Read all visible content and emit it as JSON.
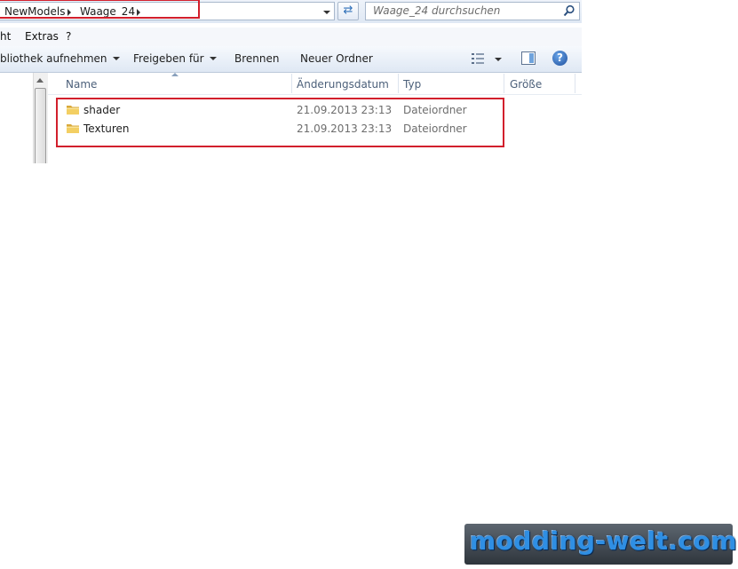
{
  "address": {
    "breadcrumbs": [
      "NewModels",
      "Waage_24"
    ],
    "search_placeholder": "Waage_24 durchsuchen"
  },
  "menu": {
    "items": [
      "ht",
      "Extras",
      "?"
    ]
  },
  "toolbar": {
    "include_library": "bliothek aufnehmen",
    "share_with": "Freigeben für",
    "burn": "Brennen",
    "new_folder": "Neuer Ordner"
  },
  "columns": {
    "name": "Name",
    "date": "Änderungsdatum",
    "type": "Typ",
    "size": "Größe"
  },
  "files": [
    {
      "name": "shader",
      "date": "21.09.2013 23:13",
      "type": "Dateiordner",
      "size": ""
    },
    {
      "name": "Texturen",
      "date": "21.09.2013 23:13",
      "type": "Dateiordner",
      "size": ""
    }
  ],
  "icons": {
    "refresh": "refresh-icon",
    "search": "search-icon",
    "views": "views-icon",
    "preview_pane": "preview-pane-icon",
    "help": "help-icon",
    "folder": "folder-icon"
  },
  "colors": {
    "highlight_box": "#d21f2c",
    "watermark_text": "#2f8fe4"
  },
  "watermark": {
    "text": "modding-welt.com"
  }
}
